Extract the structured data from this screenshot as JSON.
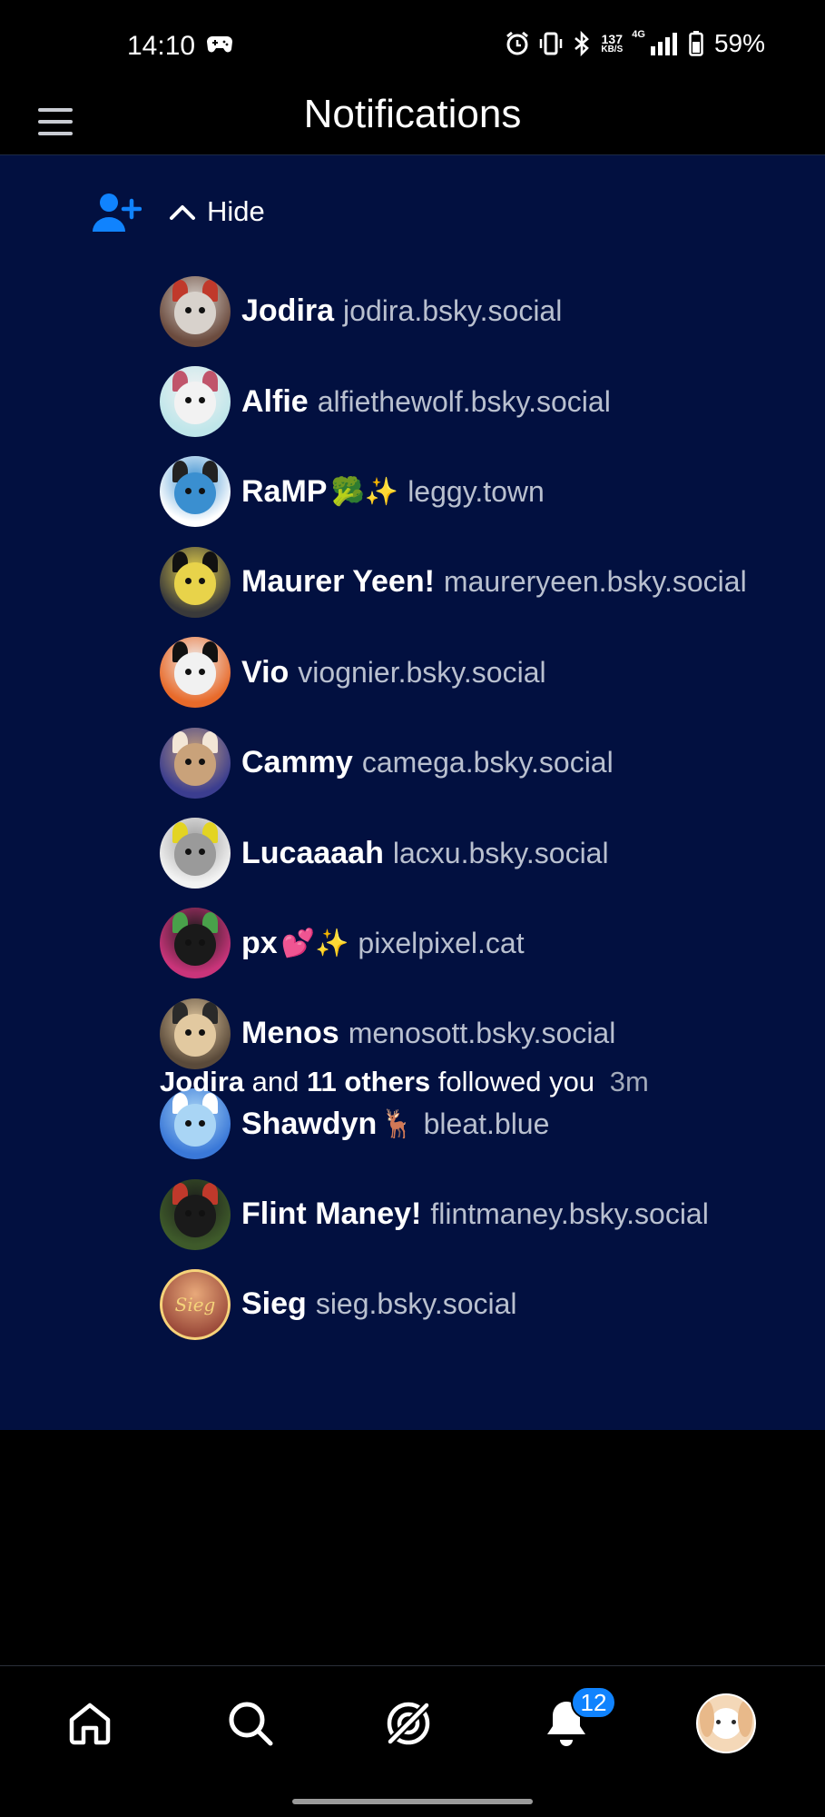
{
  "status_bar": {
    "time": "14:10",
    "net_speed_value": "137",
    "net_speed_unit": "KB/S",
    "network_type": "4G",
    "battery": "59%"
  },
  "header": {
    "title": "Notifications"
  },
  "notification": {
    "toggle_label": "Hide",
    "followers": [
      {
        "name": "Jodira",
        "emoji": "",
        "handle": "jodira.bsky.social",
        "avatar_colors": [
          "#6b4b3e",
          "#d8d2cc",
          "#c0392b"
        ]
      },
      {
        "name": "Alfie",
        "emoji": "",
        "handle": "alfiethewolf.bsky.social",
        "avatar_colors": [
          "#bfe6ea",
          "#f2f2f2",
          "#c0556b"
        ]
      },
      {
        "name": "RaMP",
        "emoji": "🥦✨",
        "handle": "leggy.town",
        "avatar_colors": [
          "#ffffff",
          "#3a8fd0",
          "#222222"
        ]
      },
      {
        "name": "Maurer Yeen!",
        "emoji": "",
        "handle": "maureryeen.bsky.social",
        "avatar_colors": [
          "#3a3a3a",
          "#e8d34a",
          "#111111"
        ]
      },
      {
        "name": "Vio",
        "emoji": "",
        "handle": "viognier.bsky.social",
        "avatar_colors": [
          "#e86a2a",
          "#f1f1f1",
          "#111111"
        ]
      },
      {
        "name": "Cammy",
        "emoji": "",
        "handle": "camega.bsky.social",
        "avatar_colors": [
          "#3b3d8f",
          "#c9a27a",
          "#f3e6d6"
        ]
      },
      {
        "name": "Lucaaaah",
        "emoji": "",
        "handle": "lacxu.bsky.social",
        "avatar_colors": [
          "#f2f2f2",
          "#9a9a9a",
          "#e3d423"
        ]
      },
      {
        "name": "px",
        "emoji": "💕✨",
        "handle": "pixelpixel.cat",
        "avatar_colors": [
          "#c9347a",
          "#1a1a1a",
          "#49a14a"
        ]
      },
      {
        "name": "Menos",
        "emoji": "",
        "handle": "menosott.bsky.social",
        "avatar_colors": [
          "#5a4a3a",
          "#e2c9a0",
          "#2a2a2a"
        ]
      },
      {
        "name": "Shawdyn",
        "emoji": "🦌",
        "handle": "bleat.blue",
        "avatar_colors": [
          "#3a78d8",
          "#a9d5f5",
          "#ffffff"
        ]
      },
      {
        "name": "Flint Maney!",
        "emoji": "",
        "handle": "flintmaney.bsky.social",
        "avatar_colors": [
          "#3e5a2a",
          "#1a1a1a",
          "#c0392b"
        ]
      },
      {
        "name": "Sieg",
        "emoji": "",
        "handle": "sieg.bsky.social",
        "avatar_colors": [
          "#9b4a3a",
          "#e8a97a",
          "#f5d37a"
        ],
        "avatar_text": "Sieg"
      }
    ],
    "summary": {
      "actor": "Jodira",
      "connector": "and",
      "others": "11 others",
      "action": "followed you",
      "ago": "3m"
    }
  },
  "bottom_nav": {
    "items": [
      "home-icon",
      "search-icon",
      "feeds-icon",
      "notifications-icon",
      "profile-avatar"
    ],
    "notification_badge": "12"
  },
  "colors": {
    "card_bg": "#021040",
    "accent": "#1083fe",
    "handle_text": "#b9c0cf"
  }
}
